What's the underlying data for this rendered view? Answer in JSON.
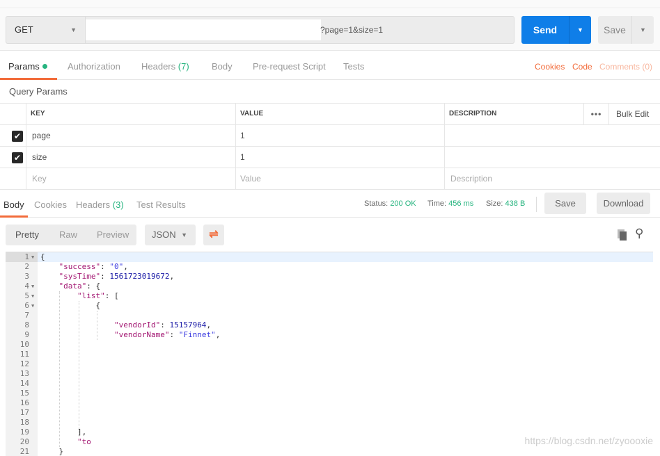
{
  "request": {
    "method": "GET",
    "url_suffix": "?page=1&size=1",
    "send_label": "Send",
    "save_label": "Save"
  },
  "tabs": [
    {
      "label": "Params"
    },
    {
      "label": "Authorization"
    },
    {
      "label": "Headers",
      "count": "(7)"
    },
    {
      "label": "Body"
    },
    {
      "label": "Pre-request Script"
    },
    {
      "label": "Tests"
    }
  ],
  "links": {
    "cookies": "Cookies",
    "code": "Code",
    "comments": "Comments (0)"
  },
  "query_params": {
    "title": "Query Params",
    "headers": [
      "KEY",
      "VALUE",
      "DESCRIPTION"
    ],
    "bulk_edit": "Bulk Edit",
    "rows": [
      {
        "checked": true,
        "key": "page",
        "value": "1"
      },
      {
        "checked": true,
        "key": "size",
        "value": "1"
      }
    ],
    "placeholders": {
      "key": "Key",
      "value": "Value",
      "description": "Description"
    }
  },
  "response": {
    "tabs": [
      {
        "label": "Body"
      },
      {
        "label": "Cookies"
      },
      {
        "label": "Headers",
        "count": "(3)"
      },
      {
        "label": "Test Results"
      }
    ],
    "status_label": "Status:",
    "status": "200 OK",
    "time_label": "Time:",
    "time": "456 ms",
    "size_label": "Size:",
    "size": "438 B",
    "save_label": "Save",
    "download_label": "Download",
    "views": [
      "Pretty",
      "Raw",
      "Preview"
    ],
    "format": "JSON"
  },
  "code_lines": [
    {
      "n": "1",
      "fold": true,
      "t": "{"
    },
    {
      "n": "2",
      "t": "    \"success\": \"0\","
    },
    {
      "n": "3",
      "t": "    \"sysTime\": 1561723019672,"
    },
    {
      "n": "4",
      "fold": true,
      "t": "    \"data\": {"
    },
    {
      "n": "5",
      "fold": true,
      "t": "        \"list\": ["
    },
    {
      "n": "6",
      "fold": true,
      "t": "            {"
    },
    {
      "n": "7",
      "t": ""
    },
    {
      "n": "8",
      "t": "                \"vendorId\": 15157964,"
    },
    {
      "n": "9",
      "t": "                \"vendorName\": \"Finnet\","
    },
    {
      "n": "10",
      "t": ""
    },
    {
      "n": "11",
      "t": ""
    },
    {
      "n": "12",
      "t": ""
    },
    {
      "n": "13",
      "t": ""
    },
    {
      "n": "14",
      "t": ""
    },
    {
      "n": "15",
      "t": ""
    },
    {
      "n": "16",
      "t": ""
    },
    {
      "n": "17",
      "t": ""
    },
    {
      "n": "18",
      "t": ""
    },
    {
      "n": "19",
      "t": "        ],"
    },
    {
      "n": "20",
      "t": "        \"to"
    },
    {
      "n": "21",
      "t": "    }"
    }
  ],
  "watermark": "https://blog.csdn.net/zyoooxie",
  "colors": {
    "accent": "#f26b3a",
    "send": "#0f7ee8",
    "success": "#26b47f"
  }
}
